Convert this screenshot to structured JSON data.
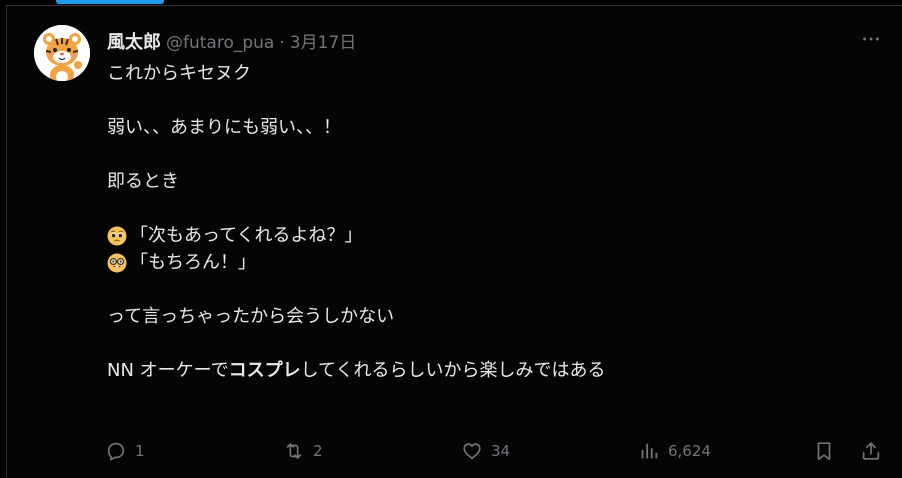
{
  "tweet": {
    "author": {
      "display_name": "風太郎",
      "handle": "@futaro_pua",
      "separator": "·",
      "date": "3月17日"
    },
    "body": {
      "line1": "これからキセヌク",
      "line2": "弱い、、あまりにも弱い、、！",
      "line3": "即るとき",
      "line4_emoji": "pleading-face-icon",
      "line4": "「次もあってくれるよね？」",
      "line5_emoji": "nerd-face-icon",
      "line5": "「もちろん！」",
      "line6": "って言っちゃったから会うしかない",
      "line7_prefix": "NN オーケーで",
      "line7_bold": "コスプレ",
      "line7_suffix": "してくれるらしいから楽しみではある"
    },
    "actions": {
      "reply_icon": "reply-icon",
      "reply_count": "1",
      "repost_icon": "repost-icon",
      "repost_count": "2",
      "like_icon": "heart-icon",
      "like_count": "34",
      "views_icon": "views-icon",
      "views_count": "6,624",
      "bookmark_icon": "bookmark-icon",
      "share_icon": "share-icon"
    },
    "more_icon": "more-icon"
  },
  "colors": {
    "background": "#000000",
    "text_primary": "#e7e9ea",
    "text_secondary": "#71767b",
    "accent": "#1d9bf0",
    "border": "#2f3336"
  }
}
